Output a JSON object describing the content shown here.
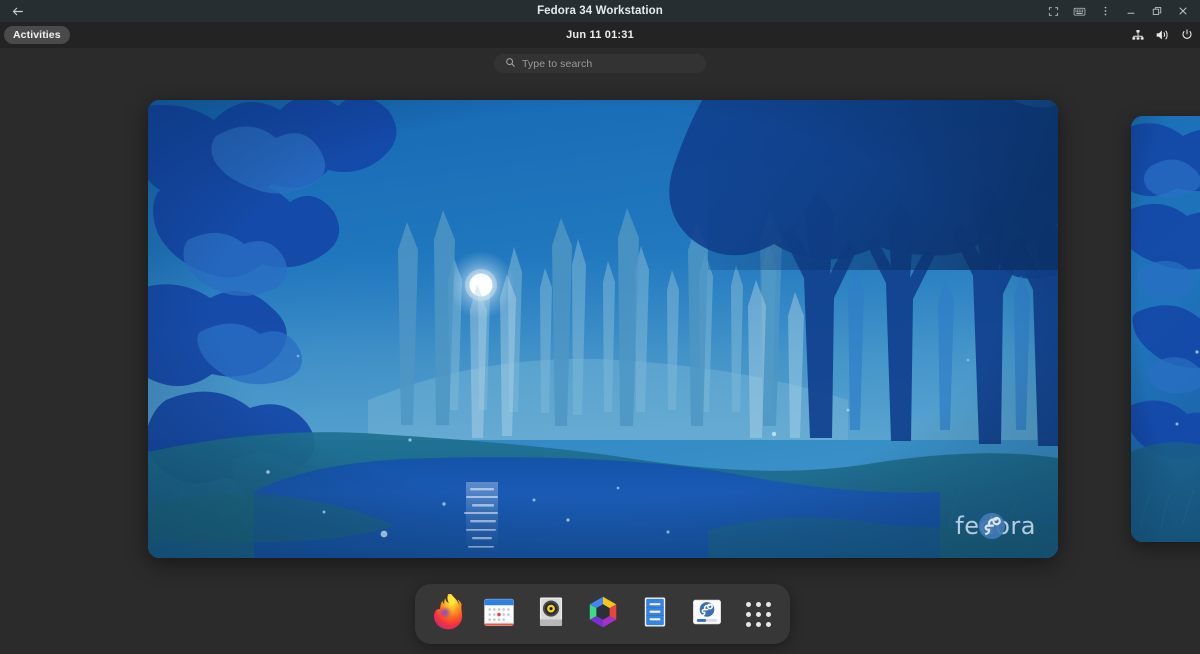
{
  "window": {
    "title": "Fedora 34 Workstation",
    "back_icon": "back-arrow-icon",
    "controls": [
      {
        "name": "fullscreen-button",
        "icon": "fullscreen-icon",
        "label": "Fullscreen"
      },
      {
        "name": "keyboard-button",
        "icon": "keyboard-icon",
        "label": "Keyboard"
      },
      {
        "name": "more-options-button",
        "icon": "kebab-menu-icon",
        "label": "More options"
      },
      {
        "name": "minimize-button",
        "icon": "minimize-icon",
        "label": "Minimize"
      },
      {
        "name": "restore-button",
        "icon": "restore-icon",
        "label": "Restore"
      },
      {
        "name": "close-button",
        "icon": "close-icon",
        "label": "Close"
      }
    ]
  },
  "topbar": {
    "activities_label": "Activities",
    "clock": "Jun 11  01:31",
    "tray": [
      {
        "name": "network-wired-icon",
        "label": "Wired network"
      },
      {
        "name": "volume-icon",
        "label": "Volume"
      },
      {
        "name": "power-icon",
        "label": "Power"
      }
    ]
  },
  "search": {
    "placeholder": "Type to search",
    "value": "",
    "icon": "search-icon"
  },
  "workspaces": [
    {
      "name": "workspace-1",
      "active": true,
      "wallpaper": "fedora-34-forest-night"
    },
    {
      "name": "workspace-2",
      "active": false,
      "wallpaper": "fedora-34-forest-night"
    }
  ],
  "wallpaper": {
    "watermark_text": "fedora",
    "logo_icon": "fedora-logo-icon"
  },
  "dock": {
    "items": [
      {
        "name": "dock-item-firefox",
        "label": "Firefox",
        "icon": "firefox-icon"
      },
      {
        "name": "dock-item-calendar",
        "label": "Calendar",
        "icon": "calendar-icon"
      },
      {
        "name": "dock-item-rhythmbox",
        "label": "Rhythmbox",
        "icon": "rhythmbox-icon"
      },
      {
        "name": "dock-item-photos",
        "label": "Photos",
        "icon": "photos-icon"
      },
      {
        "name": "dock-item-files",
        "label": "Files",
        "icon": "files-icon"
      },
      {
        "name": "dock-item-software",
        "label": "Software",
        "icon": "software-icon"
      },
      {
        "name": "dock-item-show-apps",
        "label": "Show Applications",
        "icon": "apps-grid-icon"
      }
    ]
  },
  "colors": {
    "titlebar_bg": "#262e32",
    "topbar_bg": "#232323",
    "desktop_bg": "#2b2b2b",
    "dock_bg": "#373737",
    "accent_blue": "#1d6bb5",
    "fedora_blue": "#294172"
  }
}
